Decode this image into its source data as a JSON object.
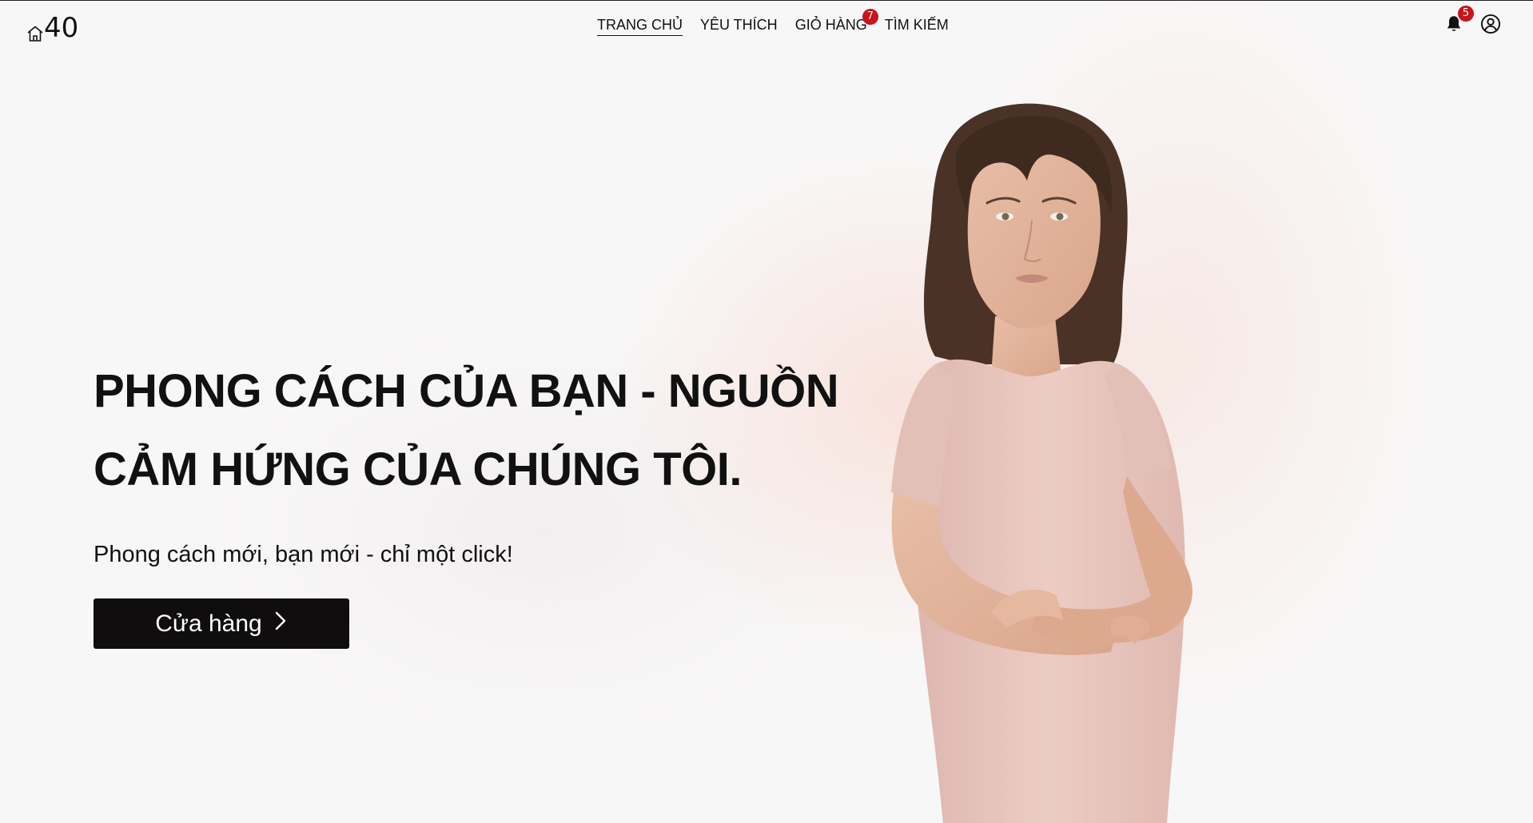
{
  "brand": {
    "logo_text": "40",
    "logo_icon": "home-icon"
  },
  "nav": {
    "items": [
      {
        "label": "TRANG CHỦ",
        "active": true
      },
      {
        "label": "YÊU THÍCH",
        "active": false
      },
      {
        "label": "GIỎ HÀNG",
        "active": false,
        "badge": "7"
      },
      {
        "label": "TÌM KIẾM",
        "active": false
      }
    ]
  },
  "header_icons": {
    "notifications": {
      "icon": "bell-icon",
      "badge": "5"
    },
    "account": {
      "icon": "user-circle-icon"
    }
  },
  "hero": {
    "title": "PHONG CÁCH CỦA BẠN - NGUỒN CẢM HỨNG CỦA CHÚNG TÔI.",
    "subtitle": "Phong cách mới, bạn mới - chỉ một click!",
    "cta_label": "Cửa hàng",
    "cta_icon": "chevron-right-icon"
  },
  "colors": {
    "text": "#111111",
    "badge": "#c8141c",
    "button_bg": "#0f0d0e",
    "shirt": "#e9c8c0",
    "skin": "#e2b59c",
    "hair": "#4a3226"
  }
}
